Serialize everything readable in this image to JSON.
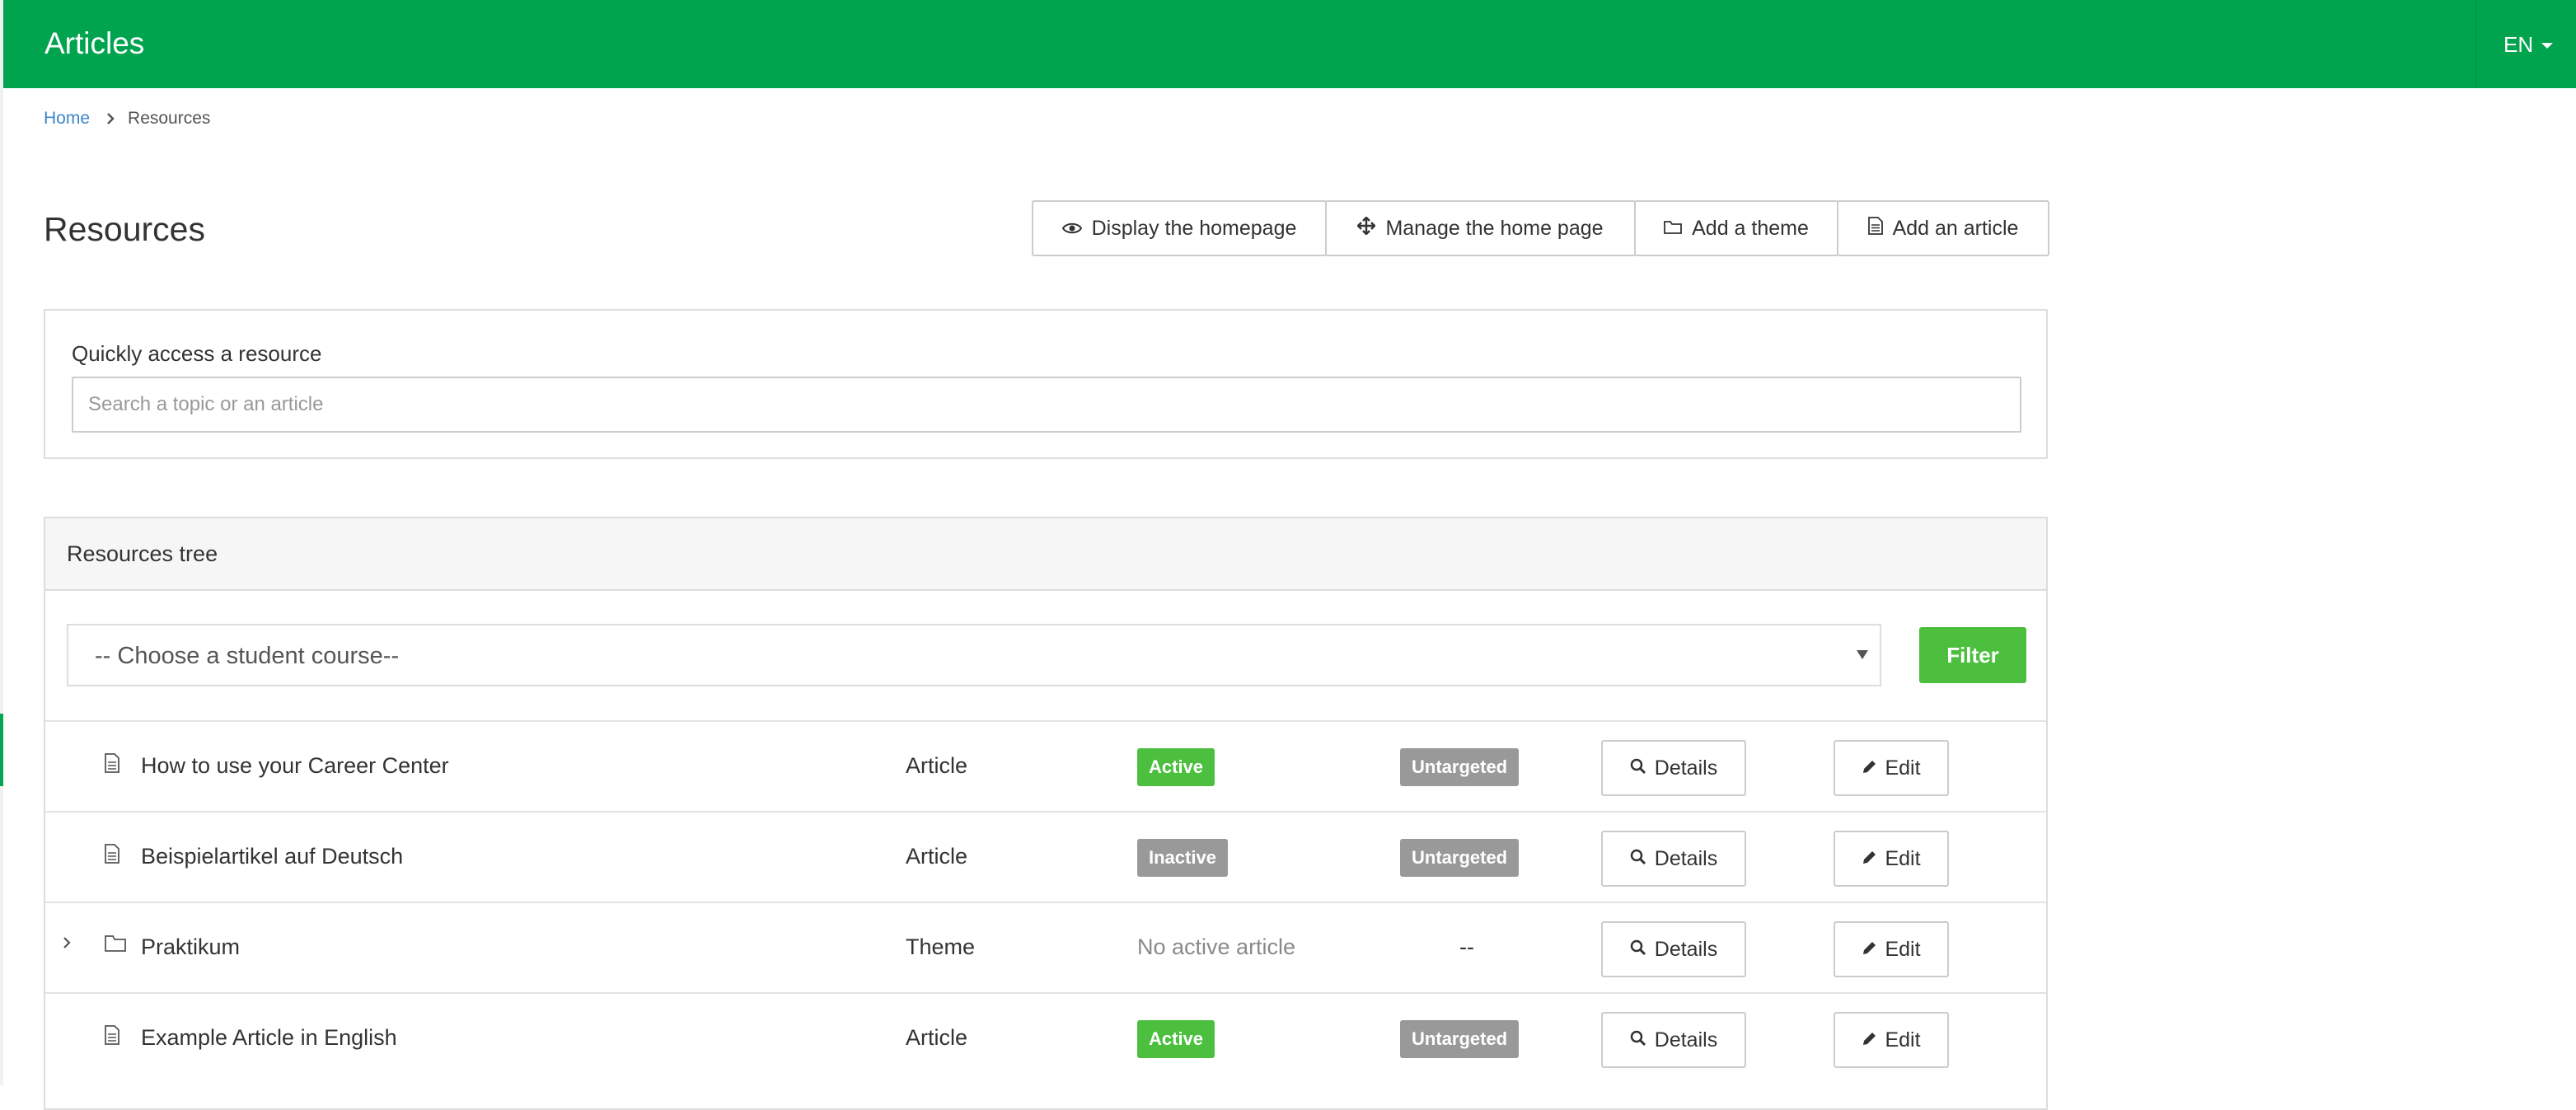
{
  "topbar": {
    "title": "Articles",
    "language": "EN"
  },
  "breadcrumb": {
    "home": "Home",
    "current": "Resources"
  },
  "page": {
    "title": "Resources"
  },
  "actions": {
    "display_homepage": "Display the homepage",
    "manage_homepage": "Manage the home page",
    "add_theme": "Add a theme",
    "add_article": "Add an article"
  },
  "quick_access": {
    "label": "Quickly access a resource",
    "placeholder": "Search a topic or an article"
  },
  "tree": {
    "title": "Resources tree",
    "select_value": "-- Choose a student course--",
    "filter_label": "Filter",
    "details_label": "Details",
    "edit_label": "Edit",
    "rows": [
      {
        "title": "How to use your Career Center",
        "type": "Article",
        "status": "Active",
        "target": "Untargeted",
        "icon": "document-icon"
      },
      {
        "title": "Beispielartikel auf Deutsch",
        "type": "Article",
        "status": "Inactive",
        "target": "Untargeted",
        "icon": "document-icon"
      },
      {
        "title": "Praktikum",
        "type": "Theme",
        "status": "No active article",
        "target": "--",
        "icon": "folder-icon"
      },
      {
        "title": "Example Article in English",
        "type": "Article",
        "status": "Active",
        "target": "Untargeted",
        "icon": "document-icon"
      }
    ]
  },
  "colors": {
    "brand_green": "#00a44e",
    "active_green": "#4cbf3f",
    "inactive_gray": "#999999",
    "link_blue": "#3a86c8"
  }
}
